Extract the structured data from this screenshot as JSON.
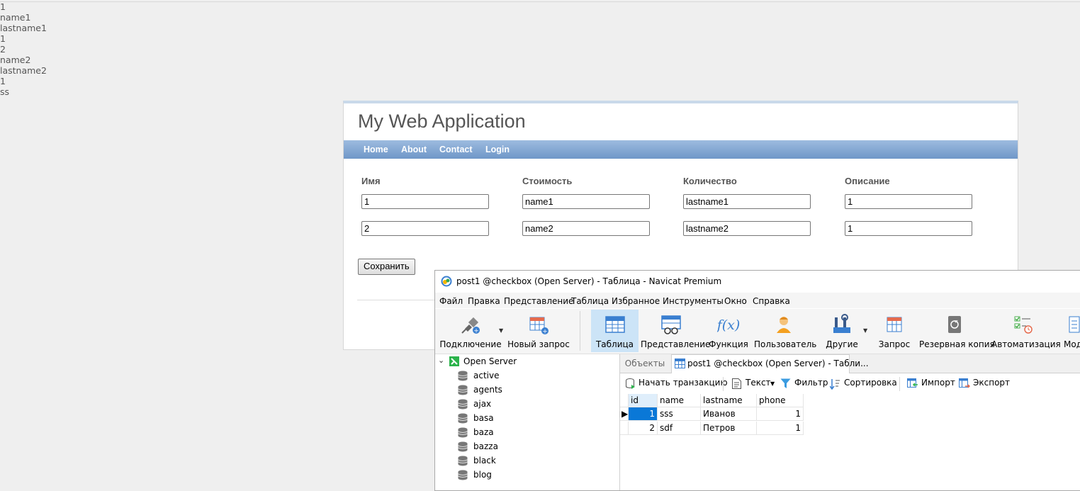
{
  "debug_output": [
    "1",
    "name1",
    "lastname1",
    "1",
    "2",
    "name2",
    "lastname2",
    "1",
    "ss"
  ],
  "webapp": {
    "title": "My Web Application",
    "nav": [
      "Home",
      "About",
      "Contact",
      "Login"
    ],
    "columns": [
      "Имя",
      "Стоимость",
      "Количество",
      "Описание"
    ],
    "rows": [
      [
        "1",
        "name1",
        "lastname1",
        "1"
      ],
      [
        "2",
        "name2",
        "lastname2",
        "1"
      ]
    ],
    "save_label": "Сохранить"
  },
  "navicat": {
    "window_title": "post1 @checkbox (Open Server) - Таблица - Navicat Premium",
    "menu": [
      "Файл",
      "Правка",
      "Представление",
      "Таблица",
      "Избранное",
      "Инструменты",
      "Окно",
      "Справка"
    ],
    "toolbar": [
      "Подключение",
      "Новый запрос",
      "Таблица",
      "Представление",
      "Функция",
      "Пользователь",
      "Другие",
      "Запрос",
      "Резервная копия",
      "Автоматизация",
      "Мод"
    ],
    "tree": {
      "connection": "Open Server",
      "databases": [
        "active",
        "agents",
        "ajax",
        "basa",
        "baza",
        "bazza",
        "black",
        "blog"
      ]
    },
    "tabs": {
      "objects": "Объекты",
      "table": "post1 @checkbox (Open Server) - Табли..."
    },
    "table_toolbar": [
      "Начать транзакцию",
      "Текст",
      "Фильтр",
      "Сортировка",
      "Импорт",
      "Экспорт"
    ],
    "grid": {
      "columns": [
        "id",
        "name",
        "lastname",
        "phone"
      ],
      "rows": [
        [
          "1",
          "sss",
          "Иванов",
          "1"
        ],
        [
          "2",
          "sdf",
          "Петров",
          "1"
        ]
      ]
    }
  }
}
